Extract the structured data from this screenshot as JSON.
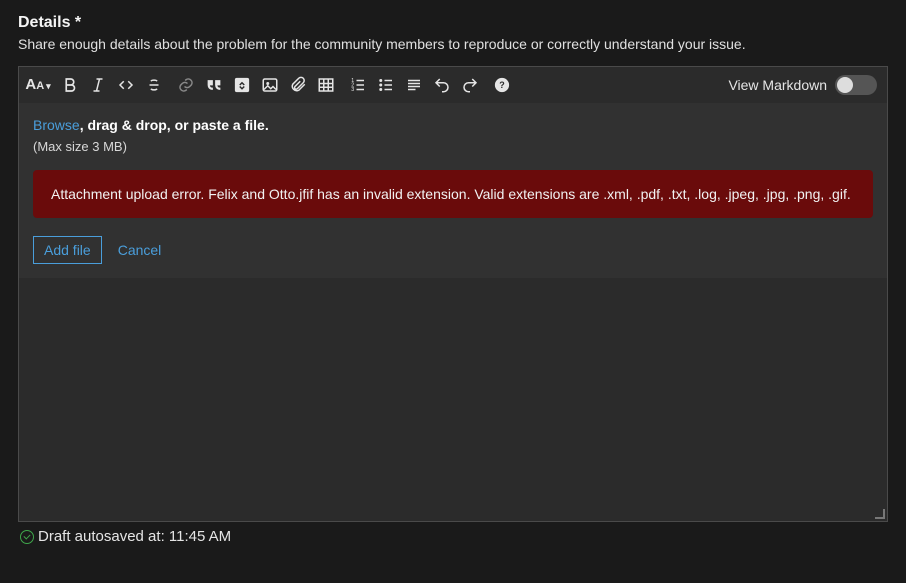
{
  "heading": "Details *",
  "subheading": "Share enough details about the problem for the community members to reproduce or correctly understand your issue.",
  "toolbar": {
    "view_markdown_label": "View Markdown"
  },
  "dropzone": {
    "browse_text": "Browse",
    "rest_text": ", drag & drop, or paste a file.",
    "max_text": "(Max size 3 MB)",
    "add_file_label": "Add file",
    "cancel_label": "Cancel"
  },
  "error": {
    "message": "Attachment upload error. Felix and Otto.jfif has an invalid extension. Valid extensions are .xml, .pdf, .txt, .log, .jpeg, .jpg, .png, .gif."
  },
  "editor_value": "",
  "autosave": {
    "text": "Draft autosaved at: 11:45 AM"
  }
}
